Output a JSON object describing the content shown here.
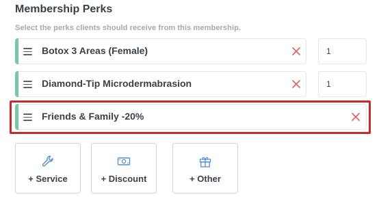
{
  "section": {
    "title": "Membership Perks",
    "subtitle": "Select the perks clients should receive from this membership."
  },
  "perks": [
    {
      "name": "Botox 3 Areas (Female)",
      "quantity": "1"
    },
    {
      "name": "Diamond-Tip Microdermabrasion",
      "quantity": "1"
    },
    {
      "name": "Friends & Family -20%",
      "highlighted": true
    }
  ],
  "add_buttons": [
    {
      "label": "+ Service",
      "icon": "wrench-icon"
    },
    {
      "label": "+ Discount",
      "icon": "cash-icon"
    },
    {
      "label": "+ Other",
      "icon": "gift-icon"
    }
  ],
  "colors": {
    "accent": "#77c7a3",
    "remove": "#e15c5c",
    "icon_blue": "#4a90d9",
    "highlight": "#c72a2a"
  }
}
